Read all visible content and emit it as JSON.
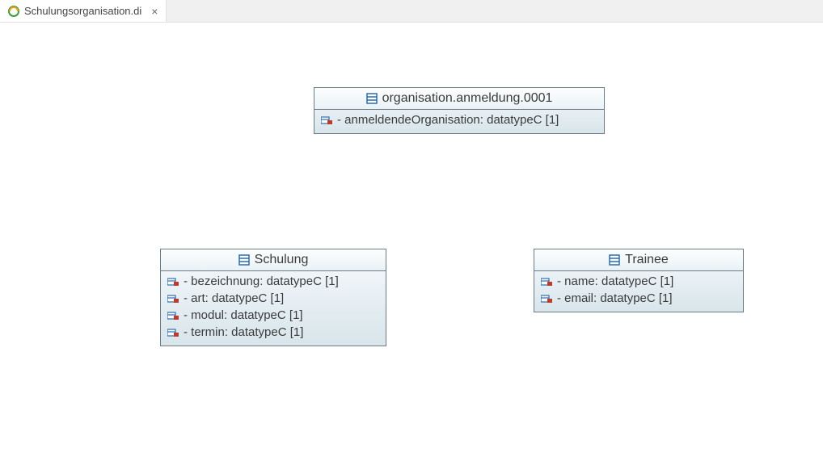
{
  "tab": {
    "label": "Schulungsorganisation.di"
  },
  "classes": {
    "organisation": {
      "title": "organisation.anmeldung.0001",
      "attrs": [
        "- anmeldendeOrganisation: datatypeC [1]"
      ]
    },
    "schulung": {
      "title": "Schulung",
      "attrs": [
        "- bezeichnung: datatypeC [1]",
        "- art: datatypeC [1]",
        "- modul: datatypeC [1]",
        "- termin: datatypeC [1]"
      ]
    },
    "trainee": {
      "title": "Trainee",
      "attrs": [
        "- name: datatypeC [1]",
        "- email: datatypeC [1]"
      ]
    }
  }
}
